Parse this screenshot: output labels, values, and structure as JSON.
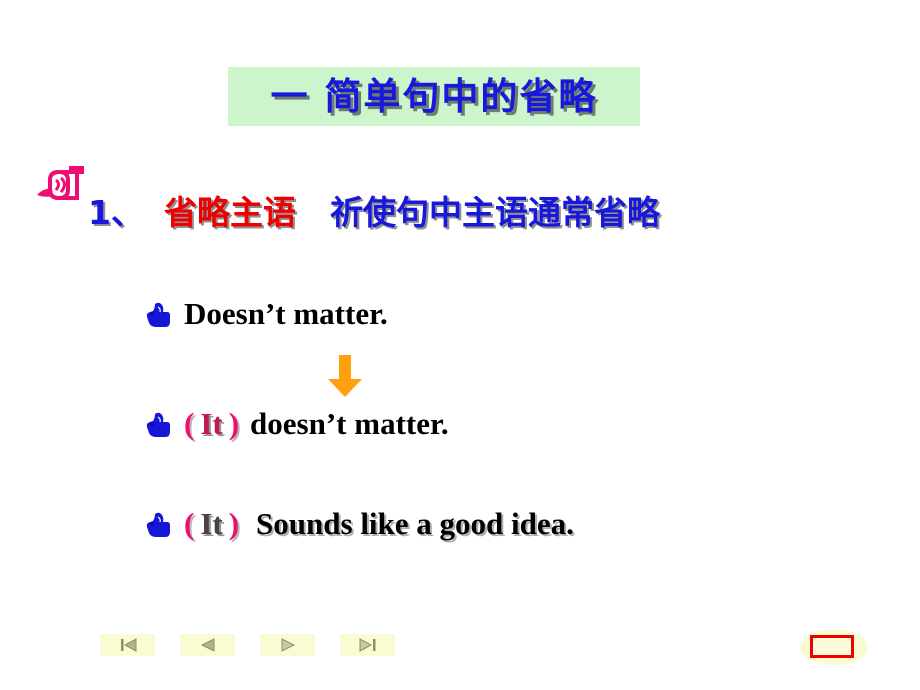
{
  "slide": {
    "title": "一  简单句中的省略",
    "title_bg_color": "#ccf5cc",
    "title_text_color": "#1818dd",
    "background_color": "#ffffff"
  },
  "heading": {
    "bullet_icon": "mailbox-icon",
    "number": "1、",
    "number_color": "#1818dd",
    "red_part": "省略主语",
    "red_part_color": "#ee0000",
    "blue_part": "祈使句中主语通常省略",
    "blue_part_color": "#1818dd"
  },
  "examples": [
    {
      "bullet_icon": "hand-pointer-icon",
      "parts": [
        {
          "text": "Doesn’t matter.",
          "color": "#000000",
          "style": "plain"
        }
      ]
    },
    {
      "bullet_icon": "hand-pointer-icon",
      "parts": [
        {
          "text": "(",
          "color": "#ee0d72",
          "style": "paren"
        },
        {
          "text": "It",
          "color": "#c2184f",
          "style": "it"
        },
        {
          "text": ")",
          "color": "#ee0d72",
          "style": "paren"
        },
        {
          "text": "doesn’t matter.",
          "color": "#000000",
          "style": "plain"
        }
      ]
    },
    {
      "bullet_icon": "hand-pointer-icon",
      "parts": [
        {
          "text": "(",
          "color": "#ee0d72",
          "style": "paren"
        },
        {
          "text": "It",
          "color": "#4a4147",
          "style": "it-dark"
        },
        {
          "text": ")",
          "color": "#ee0d72",
          "style": "paren"
        },
        {
          "text": "Sounds like a good idea.",
          "color": "#000000",
          "style": "shadowed"
        }
      ]
    }
  ],
  "arrow": {
    "icon": "arrow-down-icon",
    "color": "#ffa011"
  },
  "nav": {
    "buttons": [
      {
        "name": "first-slide-button",
        "icon": "first-icon",
        "label": "First"
      },
      {
        "name": "previous-slide-button",
        "icon": "previous-icon",
        "label": "Previous"
      },
      {
        "name": "next-slide-button",
        "icon": "next-icon",
        "label": "Next"
      },
      {
        "name": "last-slide-button",
        "icon": "last-icon",
        "label": "Last"
      }
    ],
    "button_bg_color": "#fbfbd3",
    "glyph_color": "#9d9d6e"
  },
  "return_marker": {
    "name": "return-button",
    "border_color": "#f00000",
    "fill_color": "#fdfbd8",
    "halo_color": "#fbfbd3"
  }
}
